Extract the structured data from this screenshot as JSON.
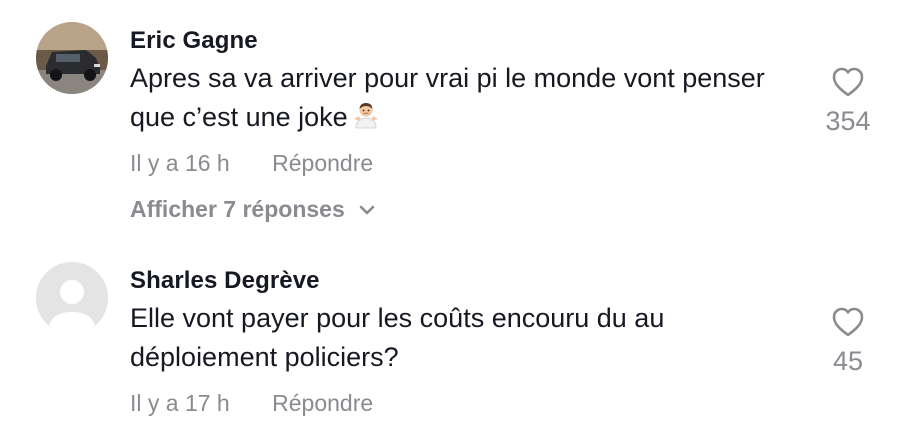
{
  "comments": [
    {
      "username": "Eric Gagne",
      "text": "Apres sa va arriver pour vrai pi le monde vont penser que c’est une joke",
      "time": "Il y a 16 h",
      "reply_label": "Répondre",
      "likes": "354",
      "view_replies_label": "Afficher 7 réponses",
      "avatar_icon": "truck-photo-avatar",
      "emoji_icon": "person-shrugging-emoji"
    },
    {
      "username": "Sharles Degrève",
      "text": "Elle vont payer pour les coûts encouru du au déploiement policiers?",
      "time": "Il y a 17 h",
      "reply_label": "Répondre",
      "likes": "45",
      "avatar_icon": "default-user-avatar"
    }
  ],
  "colors": {
    "primary_text": "#161823",
    "secondary_text": "#8a8b91",
    "background": "#ffffff"
  }
}
